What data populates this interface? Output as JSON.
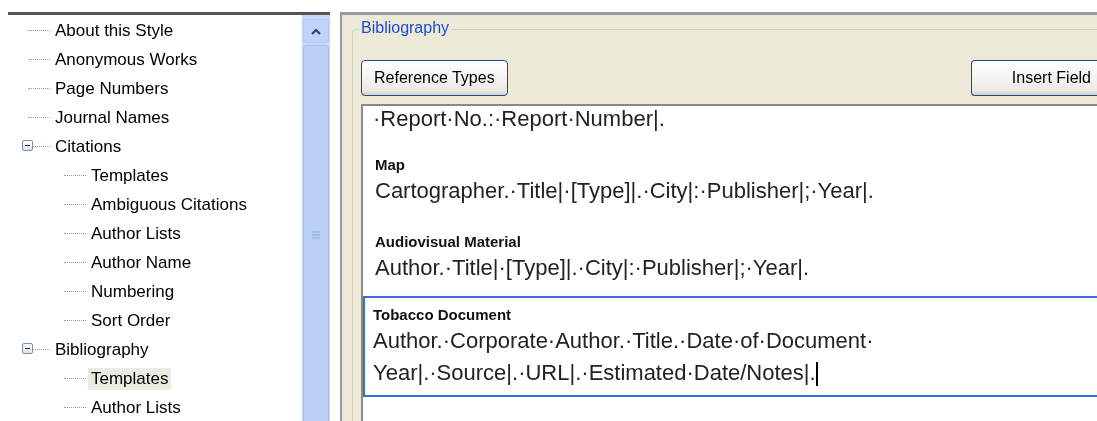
{
  "tree": {
    "items": [
      {
        "label": "About this Style",
        "selected": false
      },
      {
        "label": "Anonymous Works",
        "selected": false
      },
      {
        "label": "Page Numbers",
        "selected": false
      },
      {
        "label": "Journal Names",
        "selected": false
      },
      {
        "label": "Citations",
        "selected": false,
        "expanded": true,
        "children": [
          {
            "label": "Templates",
            "selected": false
          },
          {
            "label": "Ambiguous Citations",
            "selected": false
          },
          {
            "label": "Author Lists",
            "selected": false
          },
          {
            "label": "Author Name",
            "selected": false
          },
          {
            "label": "Numbering",
            "selected": false
          },
          {
            "label": "Sort Order",
            "selected": false
          }
        ]
      },
      {
        "label": "Bibliography",
        "selected": false,
        "expanded": true,
        "children": [
          {
            "label": "Templates",
            "selected": true
          },
          {
            "label": "Author Lists",
            "selected": false
          }
        ]
      }
    ]
  },
  "panel": {
    "title": "Bibliography",
    "buttons": [
      "Reference Types",
      "Insert Field"
    ],
    "editor": {
      "partial_line": "·Report·No.:·Report·Number|.",
      "templates": [
        {
          "type": "Map",
          "template": "Cartographer.·Title|·[Type]|.·City|:·Publisher|;·Year|.",
          "selected": false
        },
        {
          "type": "Audiovisual Material",
          "template": "Author.·Title|·[Type]|.·City|:·Publisher|;·Year|.",
          "selected": false
        },
        {
          "type": "Tobacco Document",
          "template_lines": [
            "Author.·Corporate·Author.·Title.·Date·of·Document·",
            "Year|.·Source|.·URL|.·Estimated·Date/Notes|."
          ],
          "selected": true
        }
      ]
    }
  }
}
